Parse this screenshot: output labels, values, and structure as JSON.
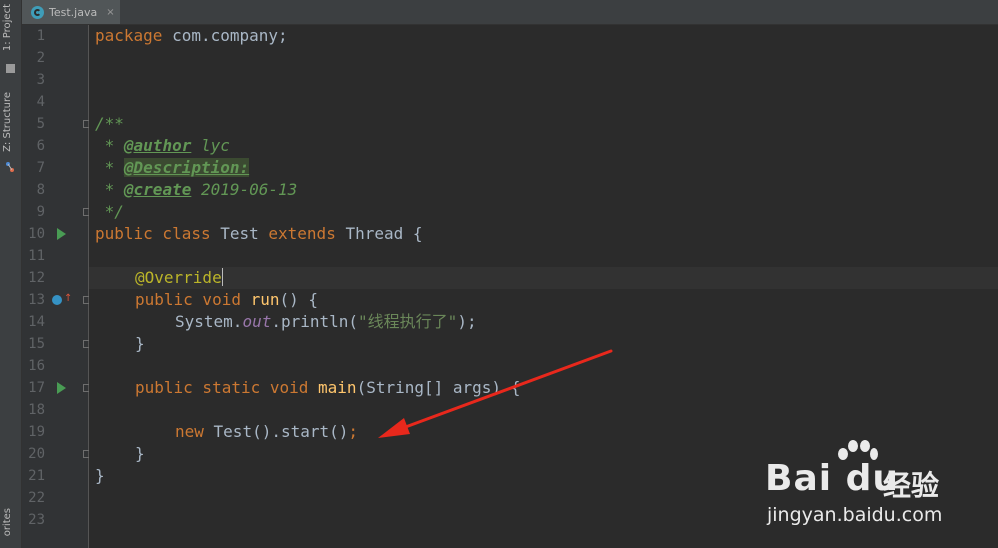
{
  "sidebar": {
    "tools": [
      {
        "label": "1: Project"
      },
      {
        "label": "Z: Structure"
      },
      {
        "label": "orites"
      }
    ]
  },
  "editor": {
    "tab": {
      "label": "Test.java",
      "close": "×"
    },
    "lines": [
      {
        "num": "1"
      },
      {
        "num": "2"
      },
      {
        "num": "3"
      },
      {
        "num": "4"
      },
      {
        "num": "5"
      },
      {
        "num": "6"
      },
      {
        "num": "7"
      },
      {
        "num": "8"
      },
      {
        "num": "9"
      },
      {
        "num": "10"
      },
      {
        "num": "11"
      },
      {
        "num": "12"
      },
      {
        "num": "13"
      },
      {
        "num": "14"
      },
      {
        "num": "15"
      },
      {
        "num": "16"
      },
      {
        "num": "17"
      },
      {
        "num": "18"
      },
      {
        "num": "19"
      },
      {
        "num": "20"
      },
      {
        "num": "21"
      },
      {
        "num": "22"
      },
      {
        "num": "23"
      }
    ],
    "code": {
      "l1": {
        "kw": "package",
        "rest": " com.company;"
      },
      "l5": "/**",
      "l6": {
        "pre": " * ",
        "tag": "@author",
        "rest": " lyc"
      },
      "l7": {
        "pre": " * ",
        "tag": "@Description:"
      },
      "l8": {
        "pre": " * ",
        "tag": "@create",
        "rest": " 2019-06-13"
      },
      "l9": " */",
      "l10": {
        "kw1": "public class",
        "name": " Test ",
        "kw2": "extends",
        "rest": " Thread {"
      },
      "l12": "@Override",
      "l13": {
        "kw": "public void",
        "fn": "run",
        "rest": "() {"
      },
      "l14": {
        "pre": "System.",
        "fld": "out",
        "mid": ".println(",
        "str": "\"线程执行了\"",
        "rest": ");"
      },
      "l15": "}",
      "l17": {
        "kw": "public static void",
        "fn": "main",
        "rest": "(String[] args) {"
      },
      "l19": {
        "kw": "new",
        "rest": " Test().start()",
        "semi": ";"
      },
      "l20": "}",
      "l21": "}"
    }
  },
  "watermark": {
    "logo": "Bai du",
    "cn": "经验",
    "url": "jingyan.baidu.com"
  },
  "colors": {
    "background": "#2b2b2b",
    "keyword": "#cc7832",
    "comment": "#629755",
    "annotation": "#bbb529",
    "function": "#ffc66d",
    "string": "#6a8759",
    "arrow": "#e8281c"
  }
}
